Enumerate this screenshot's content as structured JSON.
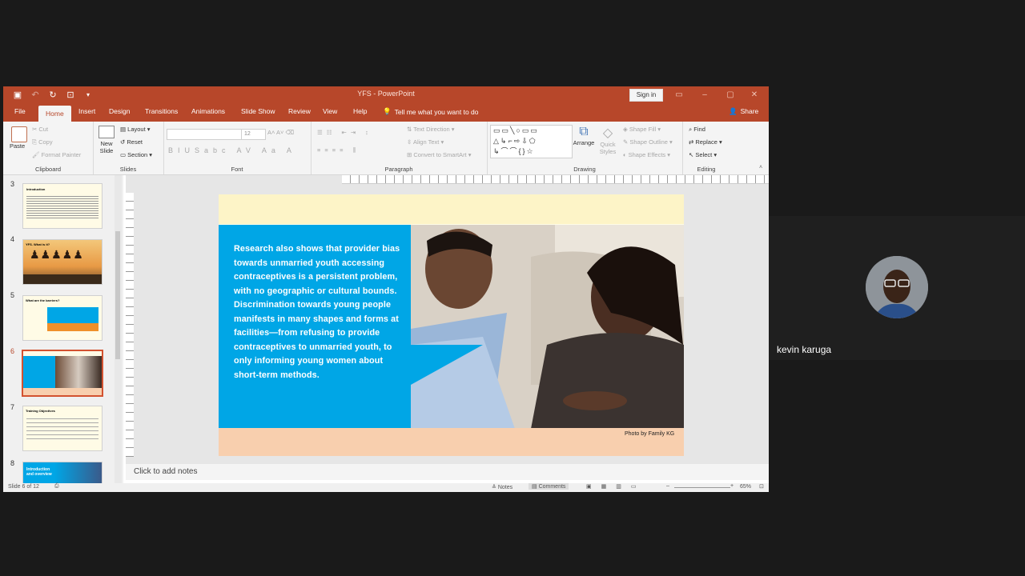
{
  "window": {
    "title": "YFS - PowerPoint",
    "sign_in": "Sign in"
  },
  "tabs": [
    {
      "label": "File"
    },
    {
      "label": "Home"
    },
    {
      "label": "Insert"
    },
    {
      "label": "Design"
    },
    {
      "label": "Transitions"
    },
    {
      "label": "Animations"
    },
    {
      "label": "Slide Show"
    },
    {
      "label": "Review"
    },
    {
      "label": "View"
    },
    {
      "label": "Help"
    }
  ],
  "tell_me": "Tell me what you want to do",
  "share": "Share",
  "ribbon": {
    "clipboard": {
      "paste": "Paste",
      "cut": "Cut",
      "copy": "Copy",
      "format_painter": "Format Painter",
      "label": "Clipboard"
    },
    "slides": {
      "new_slide": "New Slide",
      "layout": "Layout",
      "reset": "Reset",
      "section": "Section",
      "label": "Slides"
    },
    "font": {
      "size": "12",
      "label": "Font"
    },
    "paragraph": {
      "text_direction": "Text Direction",
      "align_text": "Align Text",
      "convert_smartart": "Convert to SmartArt",
      "label": "Paragraph"
    },
    "drawing": {
      "arrange": "Arrange",
      "quick_styles": "Quick Styles",
      "shape_fill": "Shape Fill",
      "shape_outline": "Shape Outline",
      "shape_effects": "Shape Effects",
      "label": "Drawing"
    },
    "editing": {
      "find": "Find",
      "replace": "Replace",
      "select": "Select",
      "label": "Editing"
    }
  },
  "thumbnails": [
    {
      "number": "3",
      "title": "Introduction"
    },
    {
      "number": "4",
      "title": "YFS. What is it?"
    },
    {
      "number": "5",
      "title": "What are the barriers?"
    },
    {
      "number": "6",
      "title": ""
    },
    {
      "number": "7",
      "title": "Training Objectives"
    },
    {
      "number": "8",
      "title": "Introduction and overview"
    }
  ],
  "slide": {
    "body": "Research also shows that provider bias towards unmarried youth accessing contraceptives is a persistent problem, with no geographic or cultural bounds. Discrimination towards young people manifests in many shapes and forms at facilities—from refusing to provide contraceptives to unmarried youth, to only informing young women about short-term methods.",
    "credit": "Photo by Family KG"
  },
  "notes_placeholder": "Click to add notes",
  "status": {
    "slide_indicator": "Slide 6 of 12",
    "notes": "Notes",
    "comments": "Comments",
    "zoom": "65%"
  },
  "participant": {
    "name": "kevin karuga"
  },
  "colors": {
    "accent": "#b7472a",
    "slide_blue": "#00a6e6"
  }
}
